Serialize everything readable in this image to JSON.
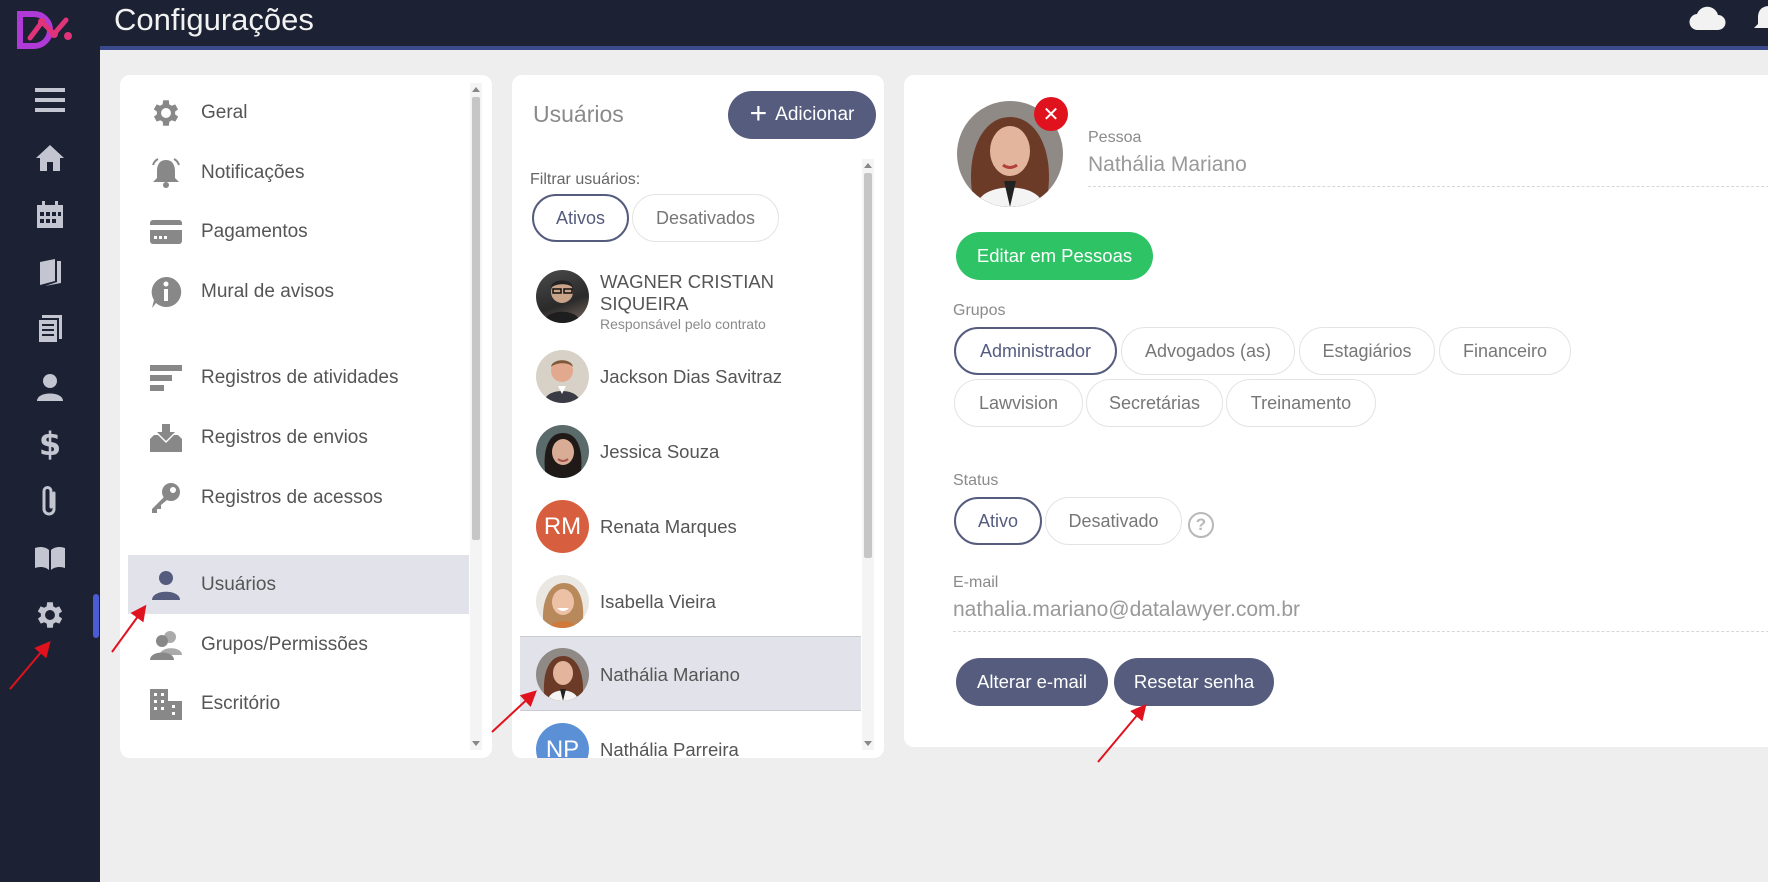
{
  "header": {
    "title": "Configurações"
  },
  "rail": {
    "icons": [
      "logo-icon",
      "hamburger-menu-icon",
      "home-icon",
      "calendar-icon",
      "book-icon",
      "document-icon",
      "person-icon",
      "dollar-icon",
      "paperclip-icon",
      "open-book-icon",
      "gear-icon"
    ]
  },
  "settings_menu": {
    "items": [
      {
        "label": "Geral",
        "icon": "gear-icon"
      },
      {
        "label": "Notificações",
        "icon": "bell-icon"
      },
      {
        "label": "Pagamentos",
        "icon": "credit-card-icon"
      },
      {
        "label": "Mural de avisos",
        "icon": "info-icon"
      },
      {
        "label": "Registros de atividades",
        "icon": "list-icon"
      },
      {
        "label": "Registros de envios",
        "icon": "inbox-download-icon"
      },
      {
        "label": "Registros de acessos",
        "icon": "key-icon"
      },
      {
        "label": "Usuários",
        "icon": "user-icon",
        "active": true
      },
      {
        "label": "Grupos/Permissões",
        "icon": "users-group-icon"
      },
      {
        "label": "Escritório",
        "icon": "building-icon"
      }
    ]
  },
  "users": {
    "title": "Usuários",
    "add_label": "Adicionar",
    "filter_label": "Filtrar usuários:",
    "filters": {
      "active": "Ativos",
      "inactive": "Desativados"
    },
    "list": [
      {
        "name": "WAGNER CRISTIAN SIQUEIRA",
        "subtitle": "Responsável pelo contrato"
      },
      {
        "name": "Jackson Dias Savitraz"
      },
      {
        "name": "Jessica Souza"
      },
      {
        "name": "Renata Marques",
        "initials": "RM"
      },
      {
        "name": "Isabella Vieira"
      },
      {
        "name": "Nathália Mariano",
        "active": true
      },
      {
        "name": "Nathália Parreira",
        "initials": "NP"
      }
    ]
  },
  "detail": {
    "person_label": "Pessoa",
    "person_name": "Nathália Mariano",
    "remove_icon": "close-icon",
    "edit_button": "Editar em Pessoas",
    "groups_label": "Grupos",
    "groups": [
      "Administrador",
      "Advogados (as)",
      "Estagiários",
      "Financeiro",
      "Lawvision",
      "Secretárias",
      "Treinamento"
    ],
    "status_label": "Status",
    "status_active": "Ativo",
    "status_inactive": "Desativado",
    "help_icon": "question-circle-icon",
    "email_label": "E-mail",
    "email_value": "nathalia.mariano@datalawyer.com.br",
    "change_email_button": "Alterar e-mail",
    "reset_password_button": "Resetar senha"
  },
  "colors": {
    "rail_bg": "#1c2233",
    "accent": "#555c7e",
    "green": "#2ec466",
    "remove_red": "#e0121e",
    "annotation_arrow": "#e0121e"
  }
}
